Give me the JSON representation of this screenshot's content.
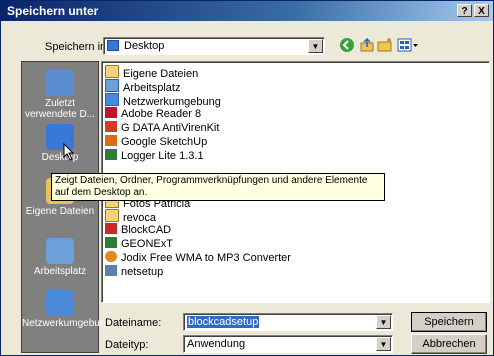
{
  "window": {
    "title": "Speichern unter",
    "help_label": "?",
    "close_label": "X"
  },
  "save_in": {
    "label": "Speichern in:",
    "value": "Desktop"
  },
  "places": [
    {
      "label": "Zuletzt verwendete D...",
      "icon": "recent-documents-icon",
      "color": "#5a8ccf"
    },
    {
      "label": "Desktop",
      "icon": "desktop-icon",
      "color": "#3a78d8"
    },
    {
      "label": "Eigene Dateien",
      "icon": "my-documents-icon",
      "color": "#e8c25a"
    },
    {
      "label": "Arbeitsplatz",
      "icon": "my-computer-icon",
      "color": "#6d9fd8"
    },
    {
      "label": "Netzwerkumgebung",
      "icon": "network-icon",
      "color": "#4a8ad8"
    }
  ],
  "files": [
    {
      "name": "Eigene Dateien",
      "icon": "folder-icon",
      "color": "#f2d27a"
    },
    {
      "name": "Arbeitsplatz",
      "icon": "computer-icon",
      "color": "#6d9fd8"
    },
    {
      "name": "Netzwerkumgebung",
      "icon": "network-icon",
      "color": "#4a8ad8"
    },
    {
      "name": "Adobe Reader 8",
      "icon": "adobe-reader-icon",
      "color": "#c8102e"
    },
    {
      "name": "G DATA AntiVirenKit",
      "icon": "gdata-icon",
      "color": "#d23a2a"
    },
    {
      "name": "Google SketchUp",
      "icon": "sketchup-icon",
      "color": "#d96b1a"
    },
    {
      "name": "Logger Lite 1.3.1",
      "icon": "logger-lite-icon",
      "color": "#2e7d32"
    },
    {
      "name": "Fotos Patricia",
      "icon": "folder-icon",
      "color": "#f2d27a"
    },
    {
      "name": "revoca",
      "icon": "folder-icon",
      "color": "#f2d27a"
    },
    {
      "name": "BlockCAD",
      "icon": "blockcad-icon",
      "color": "#c62828"
    },
    {
      "name": "GEONExT",
      "icon": "geonext-icon",
      "color": "#2e7d32"
    },
    {
      "name": "Jodix Free WMA to MP3 Converter",
      "icon": "jodix-icon",
      "color": "#e08a1e"
    },
    {
      "name": "netsetup",
      "icon": "netsetup-icon",
      "color": "#5a7fb0"
    }
  ],
  "tooltip": "Zeigt Dateien, Ordner, Programmverknüpfungen und andere Elemente auf dem Desktop an.",
  "filename": {
    "label": "Dateiname:",
    "value": "blockcadsetup"
  },
  "filetype": {
    "label": "Dateityp:",
    "value": "Anwendung"
  },
  "buttons": {
    "save": "Speichern",
    "cancel": "Abbrechen"
  }
}
